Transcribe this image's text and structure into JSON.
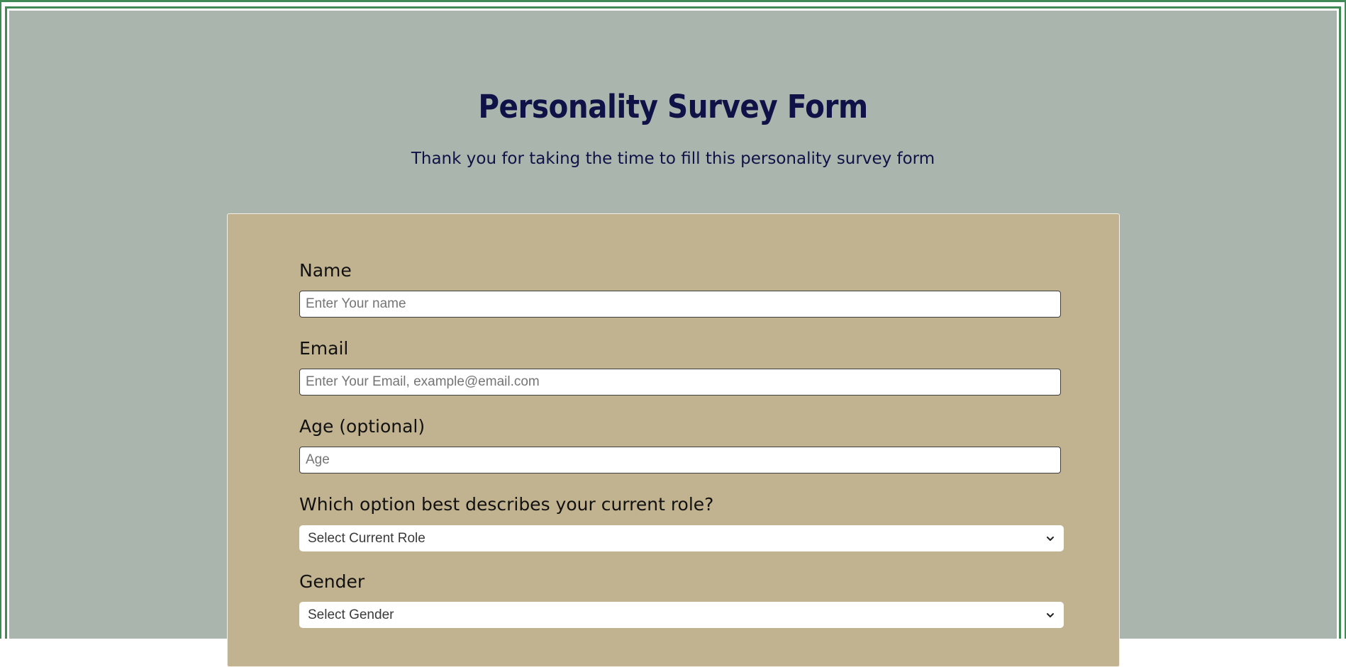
{
  "header": {
    "title": "Personality Survey Form",
    "subtitle": "Thank you for taking the time to fill this personality survey form"
  },
  "form": {
    "name": {
      "label": "Name",
      "placeholder": "Enter Your name",
      "value": ""
    },
    "email": {
      "label": "Email",
      "placeholder": "Enter Your Email, example@email.com",
      "value": ""
    },
    "age": {
      "label": "Age (optional)",
      "placeholder": "Age",
      "value": ""
    },
    "role": {
      "label": "Which option best describes your current role?",
      "selected": "Select Current Role",
      "icon": "chevron-down-icon"
    },
    "gender": {
      "label": "Gender",
      "selected": "Select Gender",
      "icon": "chevron-down-icon"
    }
  },
  "colors": {
    "page_background": "#aab6ad",
    "frame": "#3f8a55",
    "card_background": "#c2b390",
    "heading": "#0f1246",
    "label": "#111111"
  }
}
